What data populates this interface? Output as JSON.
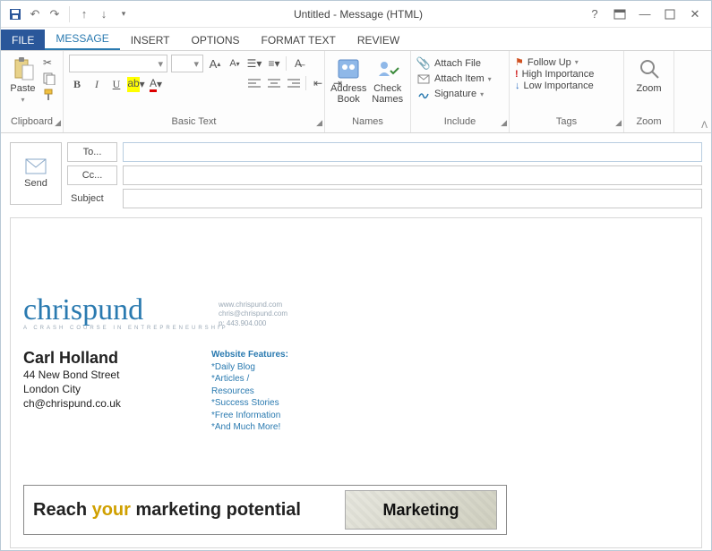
{
  "window": {
    "title": "Untitled - Message (HTML)"
  },
  "tabs": {
    "file": "FILE",
    "message": "MESSAGE",
    "insert": "INSERT",
    "options": "OPTIONS",
    "format_text": "FORMAT TEXT",
    "review": "REVIEW"
  },
  "ribbon": {
    "clipboard": {
      "paste": "Paste",
      "label": "Clipboard"
    },
    "basic_text": {
      "label": "Basic Text"
    },
    "names": {
      "address_book": "Address Book",
      "check_names": "Check Names",
      "label": "Names"
    },
    "include": {
      "attach_file": "Attach File",
      "attach_item": "Attach Item",
      "signature": "Signature",
      "label": "Include"
    },
    "tags": {
      "follow_up": "Follow Up",
      "high_importance": "High Importance",
      "low_importance": "Low Importance",
      "label": "Tags"
    },
    "zoom": {
      "zoom": "Zoom",
      "label": "Zoom"
    }
  },
  "compose": {
    "send": "Send",
    "to_btn": "To...",
    "cc_btn": "Cc...",
    "subject_label": "Subject",
    "to_value": "",
    "cc_value": "",
    "subject_value": ""
  },
  "signature": {
    "brand": "chrispund",
    "brand_sub": "A CRASH COURSE IN ENTREPRENEURSHIP",
    "brand_url": "www.chrispund.com",
    "brand_email": "chris@chrispund.com",
    "brand_phone": "p: 443.904.000",
    "name": "Carl Holland",
    "addr1": "44 New Bond Street",
    "addr2": "London City",
    "email": "ch@chrispund.co.uk",
    "features_header": "Website Features:",
    "features": [
      "*Daily Blog",
      "*Articles / Resources",
      "*Success Stories",
      "*Free Information",
      "*And Much More!"
    ]
  },
  "banner": {
    "t1": "Reach ",
    "t2": "your",
    "t3": " marketing potential",
    "magazine": "Marketing"
  }
}
